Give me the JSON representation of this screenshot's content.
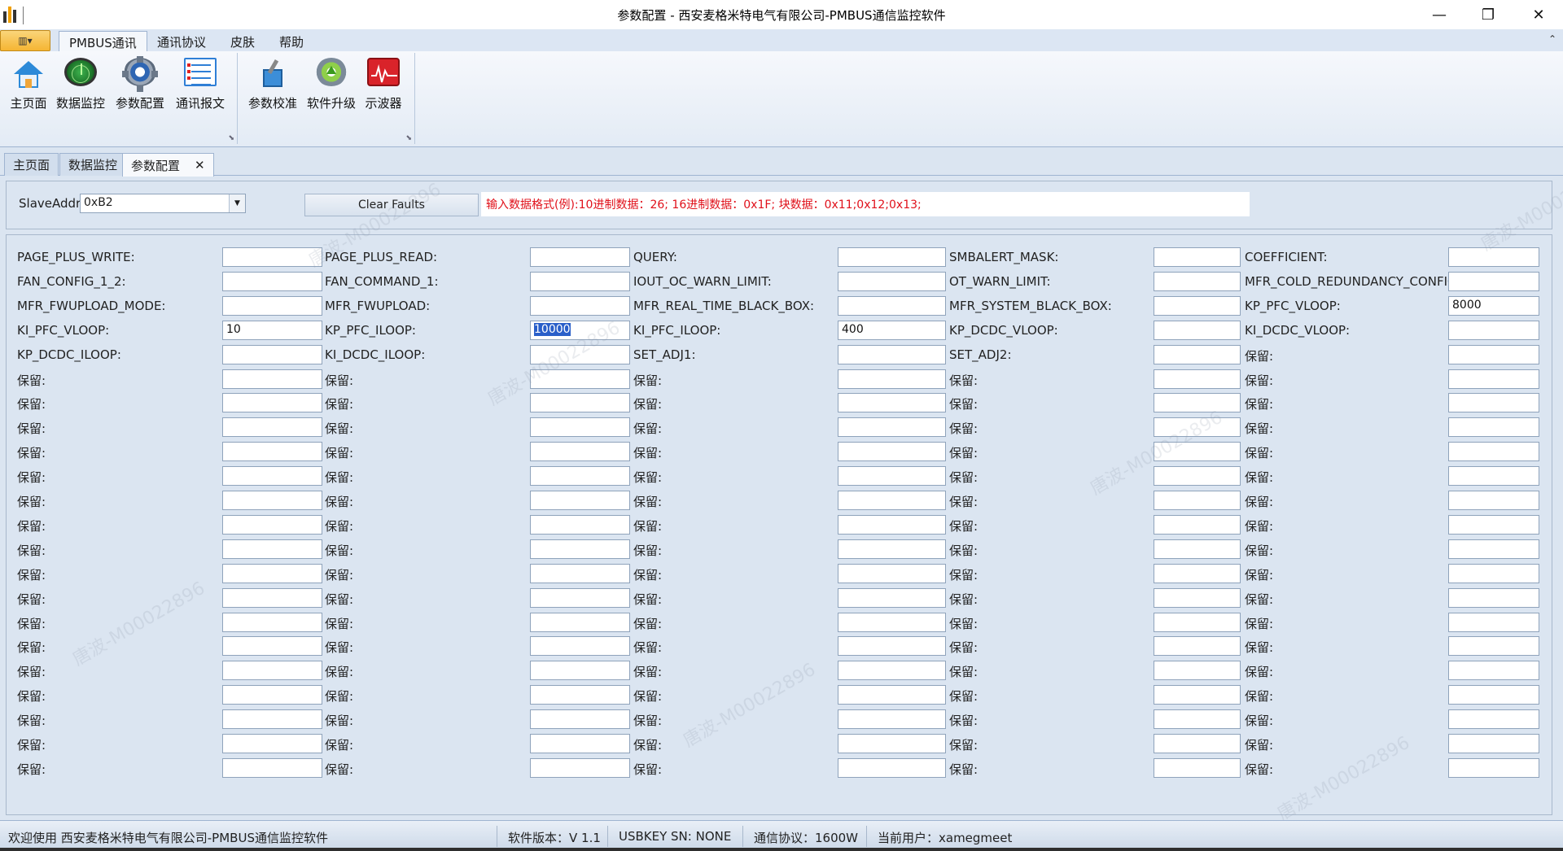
{
  "window": {
    "title": "参数配置 - 西安麦格米特电气有限公司-PMBUS通信监控软件",
    "minimize_glyph": "—",
    "maximize_glyph": "❐",
    "close_glyph": "✕"
  },
  "ribbon": {
    "app_menu_glyph": "▥▾",
    "tabs": [
      {
        "label": "PMBUS通讯"
      },
      {
        "label": "通讯协议"
      },
      {
        "label": "皮肤"
      },
      {
        "label": "帮助"
      }
    ],
    "collapse_glyph": "⌃",
    "launcher_glyph": "⬊",
    "groups": [
      {
        "buttons": [
          {
            "label": "主页面",
            "icon": "home-icon"
          },
          {
            "label": "数据监控",
            "icon": "radar-icon"
          },
          {
            "label": "参数配置",
            "icon": "gear-icon"
          },
          {
            "label": "通讯报文",
            "icon": "document-icon"
          }
        ]
      },
      {
        "buttons": [
          {
            "label": "参数校准",
            "icon": "calibration-icon"
          },
          {
            "label": "软件升级",
            "icon": "upgrade-icon"
          },
          {
            "label": "示波器",
            "icon": "oscilloscope-icon"
          }
        ]
      }
    ]
  },
  "doc_tabs": [
    {
      "label": "主页面"
    },
    {
      "label": "数据监控"
    },
    {
      "label": "参数配置",
      "close_glyph": "✕"
    }
  ],
  "top_panel": {
    "slave_label": "SlaveAddr:",
    "slave_value": "0xB2",
    "dropdown_glyph": "▼",
    "clear_button": "Clear Faults",
    "hint": "输入数据格式(例):10进制数据：26;  16进制数据：0x1F;  块数据：0x11;0x12;0x13;"
  },
  "grid": {
    "columns": [
      [
        {
          "label": "PAGE_PLUS_WRITE:",
          "value": ""
        },
        {
          "label": "FAN_CONFIG_1_2:",
          "value": ""
        },
        {
          "label": "MFR_FWUPLOAD_MODE:",
          "value": ""
        },
        {
          "label": "KI_PFC_VLOOP:",
          "value": "10"
        },
        {
          "label": "KP_DCDC_ILOOP:",
          "value": ""
        },
        {
          "label": "保留:",
          "value": ""
        },
        {
          "label": "保留:",
          "value": ""
        },
        {
          "label": "保留:",
          "value": ""
        },
        {
          "label": "保留:",
          "value": ""
        },
        {
          "label": "保留:",
          "value": ""
        },
        {
          "label": "保留:",
          "value": ""
        },
        {
          "label": "保留:",
          "value": ""
        },
        {
          "label": "保留:",
          "value": ""
        },
        {
          "label": "保留:",
          "value": ""
        },
        {
          "label": "保留:",
          "value": ""
        },
        {
          "label": "保留:",
          "value": ""
        },
        {
          "label": "保留:",
          "value": ""
        },
        {
          "label": "保留:",
          "value": ""
        },
        {
          "label": "保留:",
          "value": ""
        },
        {
          "label": "保留:",
          "value": ""
        },
        {
          "label": "保留:",
          "value": ""
        },
        {
          "label": "保留:",
          "value": ""
        }
      ],
      [
        {
          "label": "PAGE_PLUS_READ:",
          "value": ""
        },
        {
          "label": "FAN_COMMAND_1:",
          "value": ""
        },
        {
          "label": "MFR_FWUPLOAD:",
          "value": ""
        },
        {
          "label": "KP_PFC_ILOOP:",
          "value": "10000",
          "selected": true
        },
        {
          "label": "KI_DCDC_ILOOP:",
          "value": ""
        },
        {
          "label": "保留:",
          "value": ""
        },
        {
          "label": "保留:",
          "value": ""
        },
        {
          "label": "保留:",
          "value": ""
        },
        {
          "label": "保留:",
          "value": ""
        },
        {
          "label": "保留:",
          "value": ""
        },
        {
          "label": "保留:",
          "value": ""
        },
        {
          "label": "保留:",
          "value": ""
        },
        {
          "label": "保留:",
          "value": ""
        },
        {
          "label": "保留:",
          "value": ""
        },
        {
          "label": "保留:",
          "value": ""
        },
        {
          "label": "保留:",
          "value": ""
        },
        {
          "label": "保留:",
          "value": ""
        },
        {
          "label": "保留:",
          "value": ""
        },
        {
          "label": "保留:",
          "value": ""
        },
        {
          "label": "保留:",
          "value": ""
        },
        {
          "label": "保留:",
          "value": ""
        },
        {
          "label": "保留:",
          "value": ""
        }
      ],
      [
        {
          "label": "QUERY:",
          "value": ""
        },
        {
          "label": "IOUT_OC_WARN_LIMIT:",
          "value": ""
        },
        {
          "label": "MFR_REAL_TIME_BLACK_BOX:",
          "value": ""
        },
        {
          "label": "KI_PFC_ILOOP:",
          "value": "400"
        },
        {
          "label": "SET_ADJ1:",
          "value": ""
        },
        {
          "label": "保留:",
          "value": ""
        },
        {
          "label": "保留:",
          "value": ""
        },
        {
          "label": "保留:",
          "value": ""
        },
        {
          "label": "保留:",
          "value": ""
        },
        {
          "label": "保留:",
          "value": ""
        },
        {
          "label": "保留:",
          "value": ""
        },
        {
          "label": "保留:",
          "value": ""
        },
        {
          "label": "保留:",
          "value": ""
        },
        {
          "label": "保留:",
          "value": ""
        },
        {
          "label": "保留:",
          "value": ""
        },
        {
          "label": "保留:",
          "value": ""
        },
        {
          "label": "保留:",
          "value": ""
        },
        {
          "label": "保留:",
          "value": ""
        },
        {
          "label": "保留:",
          "value": ""
        },
        {
          "label": "保留:",
          "value": ""
        },
        {
          "label": "保留:",
          "value": ""
        },
        {
          "label": "保留:",
          "value": ""
        }
      ],
      [
        {
          "label": "SMBALERT_MASK:",
          "value": ""
        },
        {
          "label": "OT_WARN_LIMIT:",
          "value": ""
        },
        {
          "label": "MFR_SYSTEM_BLACK_BOX:",
          "value": ""
        },
        {
          "label": "KP_DCDC_VLOOP:",
          "value": ""
        },
        {
          "label": "SET_ADJ2:",
          "value": ""
        },
        {
          "label": "保留:",
          "value": ""
        },
        {
          "label": "保留:",
          "value": ""
        },
        {
          "label": "保留:",
          "value": ""
        },
        {
          "label": "保留:",
          "value": ""
        },
        {
          "label": "保留:",
          "value": ""
        },
        {
          "label": "保留:",
          "value": ""
        },
        {
          "label": "保留:",
          "value": ""
        },
        {
          "label": "保留:",
          "value": ""
        },
        {
          "label": "保留:",
          "value": ""
        },
        {
          "label": "保留:",
          "value": ""
        },
        {
          "label": "保留:",
          "value": ""
        },
        {
          "label": "保留:",
          "value": ""
        },
        {
          "label": "保留:",
          "value": ""
        },
        {
          "label": "保留:",
          "value": ""
        },
        {
          "label": "保留:",
          "value": ""
        },
        {
          "label": "保留:",
          "value": ""
        },
        {
          "label": "保留:",
          "value": ""
        }
      ],
      [
        {
          "label": "COEFFICIENT:",
          "value": ""
        },
        {
          "label": "MFR_COLD_REDUNDANCY_CONFIG:",
          "value": ""
        },
        {
          "label": "KP_PFC_VLOOP:",
          "value": "8000"
        },
        {
          "label": "KI_DCDC_VLOOP:",
          "value": ""
        },
        {
          "label": "保留:",
          "value": ""
        },
        {
          "label": "保留:",
          "value": ""
        },
        {
          "label": "保留:",
          "value": ""
        },
        {
          "label": "保留:",
          "value": ""
        },
        {
          "label": "保留:",
          "value": ""
        },
        {
          "label": "保留:",
          "value": ""
        },
        {
          "label": "保留:",
          "value": ""
        },
        {
          "label": "保留:",
          "value": ""
        },
        {
          "label": "保留:",
          "value": ""
        },
        {
          "label": "保留:",
          "value": ""
        },
        {
          "label": "保留:",
          "value": ""
        },
        {
          "label": "保留:",
          "value": ""
        },
        {
          "label": "保留:",
          "value": ""
        },
        {
          "label": "保留:",
          "value": ""
        },
        {
          "label": "保留:",
          "value": ""
        },
        {
          "label": "保留:",
          "value": ""
        },
        {
          "label": "保留:",
          "value": ""
        },
        {
          "label": "保留:",
          "value": ""
        }
      ]
    ]
  },
  "watermark": "唐波-M00022896",
  "status": {
    "welcome": "欢迎使用 西安麦格米特电气有限公司-PMBUS通信监控软件",
    "version": "软件版本：V 1.1",
    "usbkey": "USBKEY SN:  NONE",
    "protocol": "通信协议：1600W",
    "user": "当前用户：xamegmeet"
  }
}
